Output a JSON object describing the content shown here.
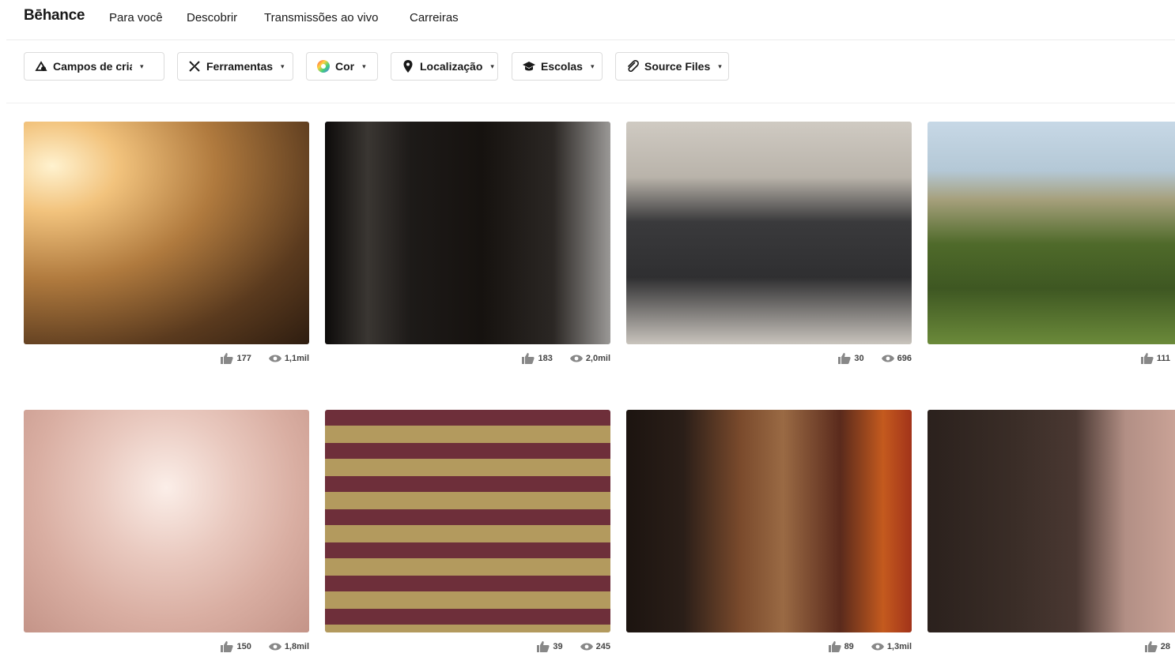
{
  "nav": {
    "logo": "Bēhance",
    "links": [
      "Para você",
      "Descobrir",
      "Transmissões ao vivo",
      "Carreiras"
    ]
  },
  "filters": [
    {
      "label": "Campos de criação",
      "icon": "creative-fields-icon"
    },
    {
      "label": "Ferramentas",
      "icon": "tools-icon"
    },
    {
      "label": "Cor",
      "icon": "color-wheel-icon"
    },
    {
      "label": "Localização",
      "icon": "location-pin-icon"
    },
    {
      "label": "Escolas",
      "icon": "graduation-cap-icon"
    },
    {
      "label": "Source Files",
      "icon": "paperclip-icon"
    }
  ],
  "projects": [
    {
      "likes": "177",
      "views": "1,1mil"
    },
    {
      "likes": "183",
      "views": "2,0mil"
    },
    {
      "likes": "30",
      "views": "696"
    },
    {
      "likes": "111",
      "views": ""
    },
    {
      "likes": "150",
      "views": "1,8mil"
    },
    {
      "likes": "39",
      "views": "245"
    },
    {
      "likes": "89",
      "views": "1,3mil"
    },
    {
      "likes": "28",
      "views": ""
    }
  ],
  "colors": {
    "text": "#191919",
    "border": "#dcdcdc",
    "stat_text": "#444444"
  }
}
